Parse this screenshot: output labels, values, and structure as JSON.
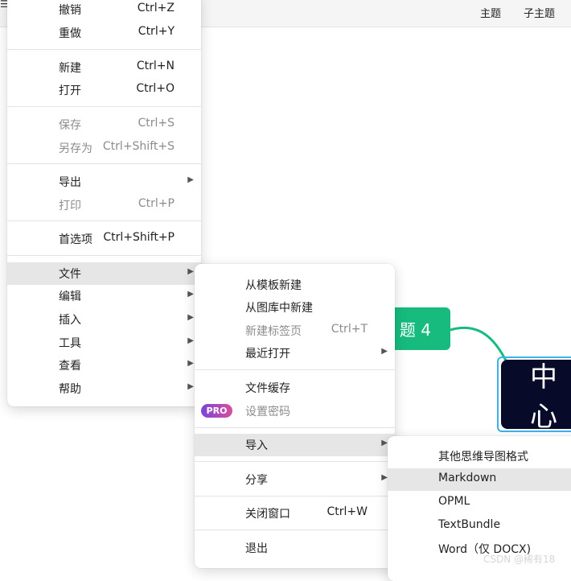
{
  "toolbar": {
    "topic": "主题",
    "subtopic": "子主题"
  },
  "canvas": {
    "topic4_label": "题 4",
    "central_label": "中心"
  },
  "main_menu": {
    "undo": {
      "label": "撤销",
      "shortcut": "Ctrl+Z"
    },
    "redo": {
      "label": "重做",
      "shortcut": "Ctrl+Y"
    },
    "new": {
      "label": "新建",
      "shortcut": "Ctrl+N"
    },
    "open": {
      "label": "打开",
      "shortcut": "Ctrl+O"
    },
    "save": {
      "label": "保存",
      "shortcut": "Ctrl+S"
    },
    "save_as": {
      "label": "另存为",
      "shortcut": "Ctrl+Shift+S"
    },
    "export": {
      "label": "导出"
    },
    "print": {
      "label": "打印",
      "shortcut": "Ctrl+P"
    },
    "preferences": {
      "label": "首选项",
      "shortcut": "Ctrl+Shift+P"
    },
    "file": {
      "label": "文件"
    },
    "edit": {
      "label": "编辑"
    },
    "insert": {
      "label": "插入"
    },
    "tools": {
      "label": "工具"
    },
    "view": {
      "label": "查看"
    },
    "help": {
      "label": "帮助"
    }
  },
  "file_menu": {
    "new_from_template": {
      "label": "从模板新建"
    },
    "new_from_gallery": {
      "label": "从图库中新建"
    },
    "new_tab": {
      "label": "新建标签页",
      "shortcut": "Ctrl+T"
    },
    "recent": {
      "label": "最近打开"
    },
    "file_cache": {
      "label": "文件缓存"
    },
    "set_password": {
      "label": "设置密码",
      "badge": "PRO"
    },
    "import": {
      "label": "导入"
    },
    "share": {
      "label": "分享"
    },
    "close_window": {
      "label": "关闭窗口",
      "shortcut": "Ctrl+W"
    },
    "quit": {
      "label": "退出"
    }
  },
  "import_menu": {
    "items": [
      "其他思维导图格式",
      "Markdown",
      "OPML",
      "TextBundle",
      "Word（仅 DOCX)"
    ]
  },
  "watermark": "CSDN @稀有18",
  "colors": {
    "topic_green": "#17bb7e",
    "central_bg": "#080a2a",
    "selection_blue": "#3cb2ea",
    "highlight": "#e6e6e6",
    "pro_gradient_start": "#7a45d8",
    "pro_gradient_end": "#d74f9c"
  }
}
